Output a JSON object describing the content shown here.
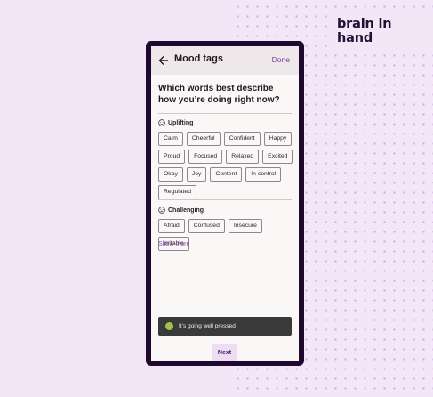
{
  "brand": {
    "logo_text": "brain in hand"
  },
  "appbar": {
    "back_icon": "arrow-left-icon",
    "title": "Mood tags",
    "done_label": "Done"
  },
  "question": "Which words best describe how you’re doing right now?",
  "sections": [
    {
      "label": "Uplifting",
      "icon": "smile-icon",
      "chips": [
        "Calm",
        "Cheerful",
        "Confident",
        "Happy",
        "Proud",
        "Focused",
        "Relaxed",
        "Excited",
        "Okay",
        "Joy",
        "Content",
        "In control",
        "Regulated"
      ]
    },
    {
      "label": "Challenging",
      "icon": "frown-icon",
      "chips": [
        "Afraid",
        "Confused",
        "Insecure",
        "Irritable"
      ]
    }
  ],
  "show_more_label": "Show more",
  "toast": {
    "text": "It’s going well pressed",
    "indicator_color": "#a3c24a"
  },
  "next_label": "Next",
  "colors": {
    "accent": "#7b3fa0",
    "background": "#f3e6f7",
    "frame": "#1e0a2e"
  }
}
